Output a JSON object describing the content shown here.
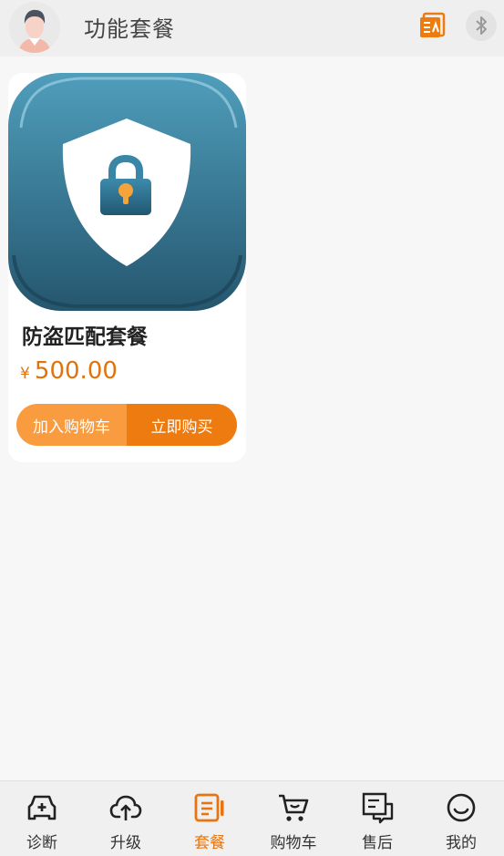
{
  "header": {
    "title": "功能套餐",
    "avatar_icon": "user-avatar-icon",
    "orders_icon": "orders-list-icon",
    "bluetooth_icon": "bluetooth-icon"
  },
  "products": [
    {
      "name": "防盗匹配套餐",
      "currency": "¥",
      "price": "500.00",
      "image_icon": "shield-lock-icon",
      "add_to_cart_label": "加入购物车",
      "buy_now_label": "立即购买"
    }
  ],
  "bottom_nav": {
    "items": [
      {
        "label": "诊断",
        "icon": "diagnosis-icon",
        "active": false
      },
      {
        "label": "升级",
        "icon": "upload-cloud-icon",
        "active": false
      },
      {
        "label": "套餐",
        "icon": "package-icon",
        "active": true
      },
      {
        "label": "购物车",
        "icon": "cart-icon",
        "active": false
      },
      {
        "label": "售后",
        "icon": "after-sales-icon",
        "active": false
      },
      {
        "label": "我的",
        "icon": "smiley-icon",
        "active": false
      }
    ]
  },
  "colors": {
    "accent": "#e8740f",
    "cart_button": "#f99b3f",
    "buy_button": "#ee7b10",
    "price": "#e0730c"
  }
}
